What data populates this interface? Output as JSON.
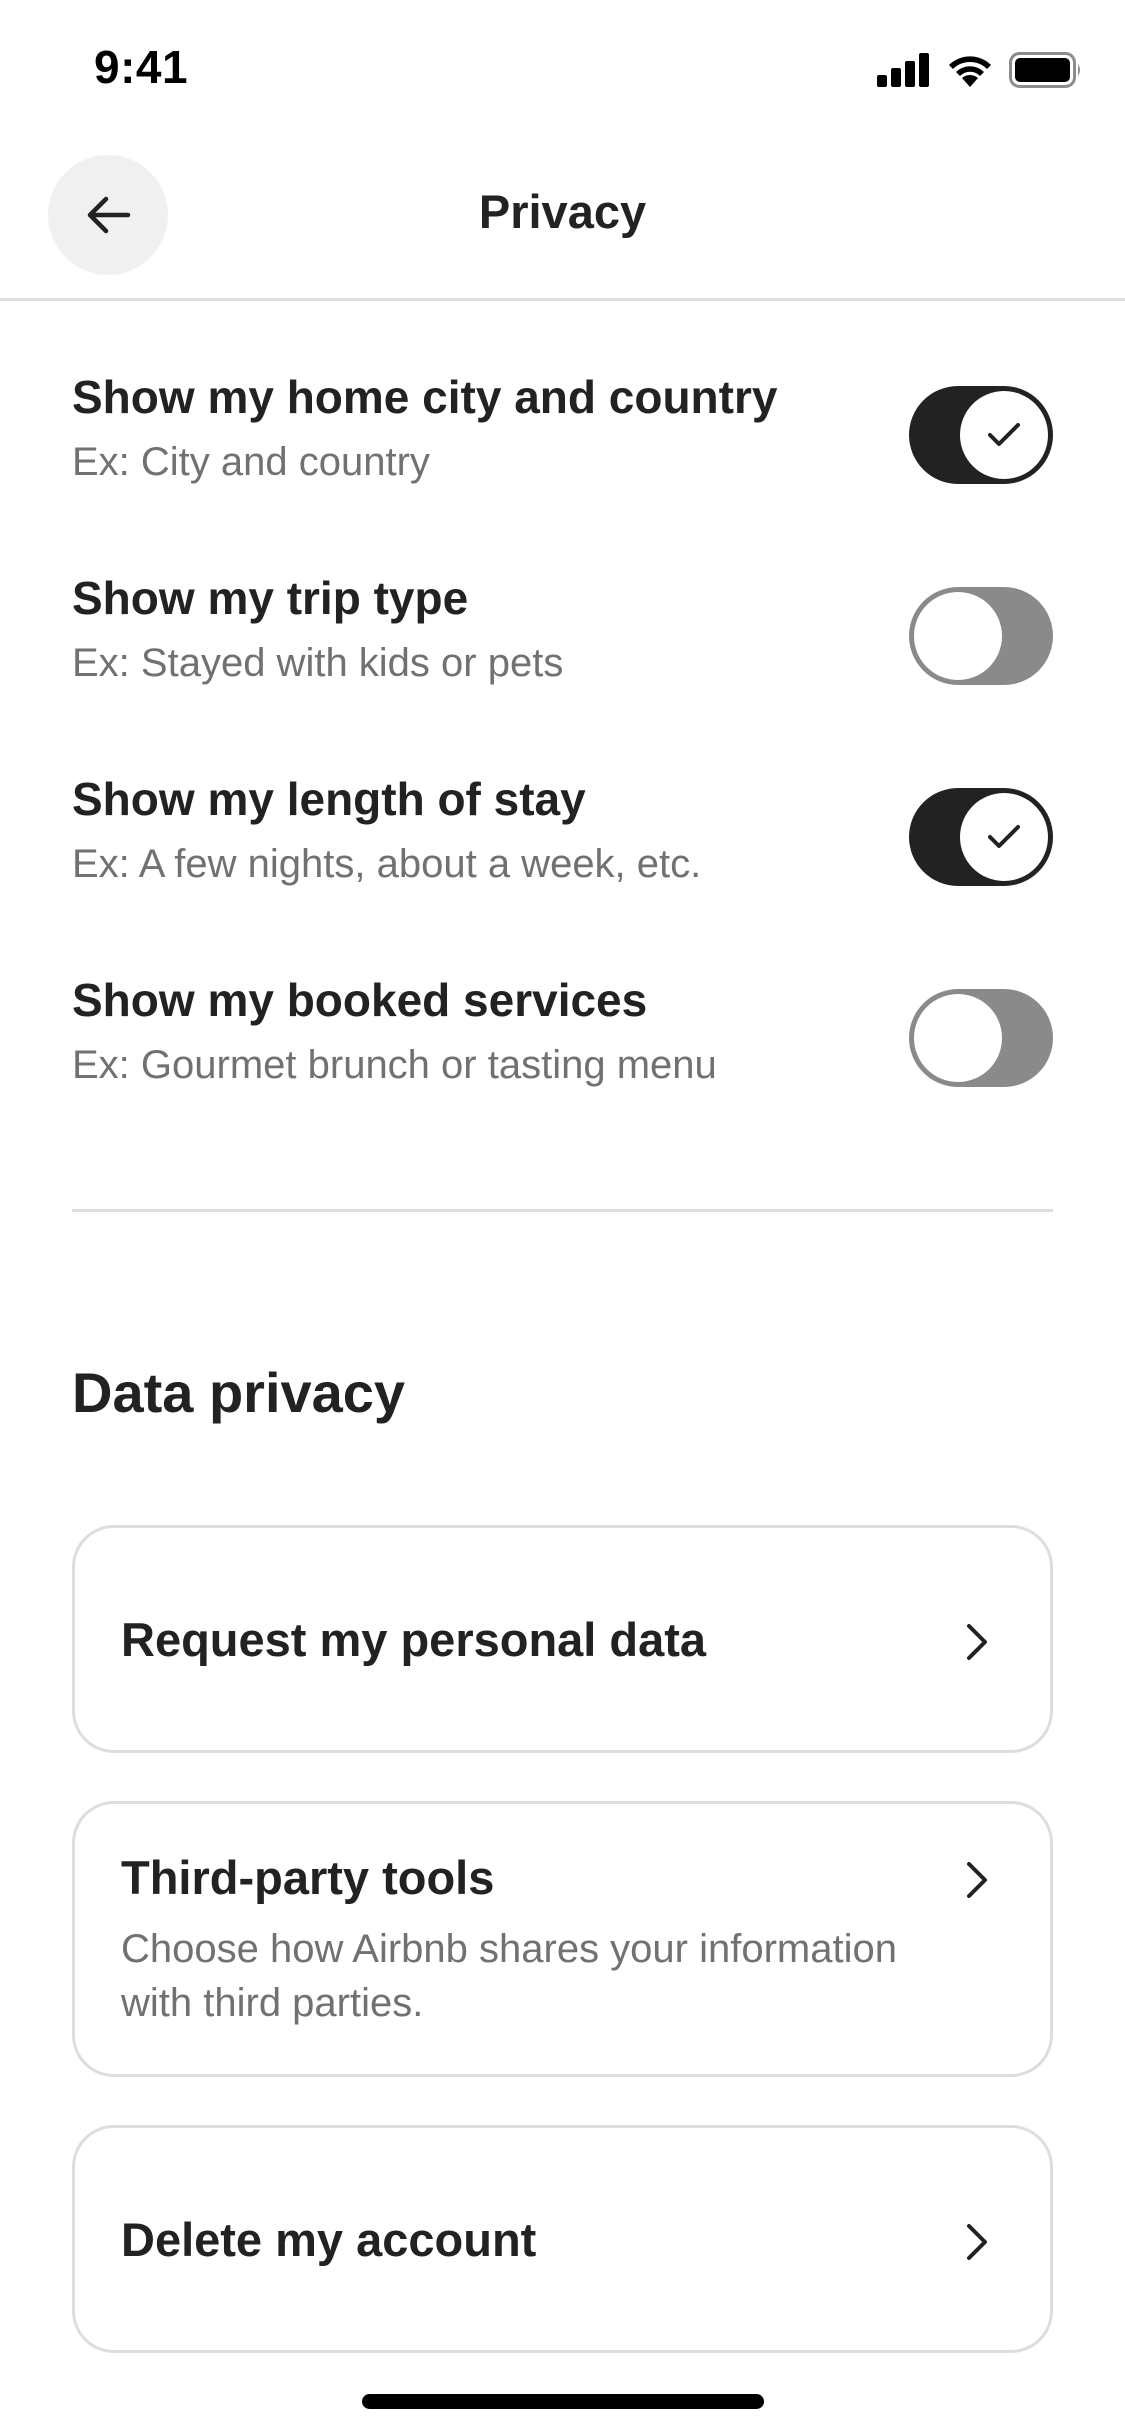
{
  "status_bar": {
    "time": "9:41"
  },
  "header": {
    "title": "Privacy",
    "back_icon": "arrow-left-icon"
  },
  "toggles": [
    {
      "title": "Show my home city and country",
      "subtitle": "Ex: City and country",
      "state": "on"
    },
    {
      "title": "Show my trip type",
      "subtitle": "Ex: Stayed with kids or pets",
      "state": "off"
    },
    {
      "title": "Show my length of stay",
      "subtitle": "Ex: A few nights, about a week, etc.",
      "state": "on"
    },
    {
      "title": "Show my booked services",
      "subtitle": "Ex: Gourmet brunch or tasting menu",
      "state": "off"
    }
  ],
  "data_privacy": {
    "section_title": "Data privacy",
    "cards": [
      {
        "title": "Request my personal data"
      },
      {
        "title": "Third-party tools",
        "description": "Choose how Airbnb shares your information with third parties."
      },
      {
        "title": "Delete my account"
      }
    ]
  },
  "colors": {
    "text": "#222222",
    "muted": "#717171",
    "toggle_on": "#222222",
    "toggle_off": "#8a8a8a",
    "border": "#dddddd"
  }
}
